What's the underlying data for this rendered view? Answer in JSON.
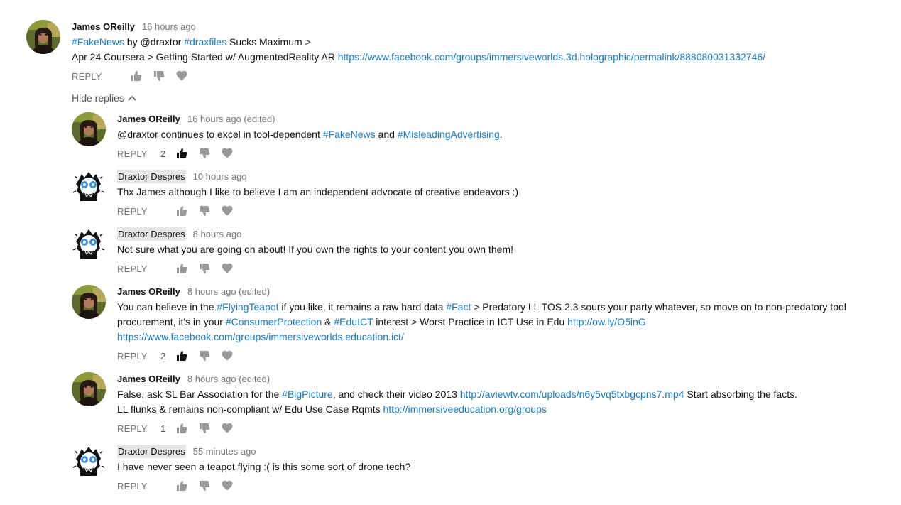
{
  "colors": {
    "link": "#167ac6",
    "meta": "#767676",
    "icon_idle": "#999999",
    "icon_active": "#111111",
    "author_highlight": "#e6e6e6"
  },
  "top_comment": {
    "author": "James OReilly",
    "time": "16 hours ago",
    "line1": {
      "tag1": "#FakeNews",
      "t1": " by @draxtor ",
      "tag2": "#draxfiles",
      "t2": " Sucks Maximum >"
    },
    "line2": {
      "t1": "Apr 24 Coursera > Getting Started w/ AugmentedReality AR ",
      "link": "https://www.facebook.com/groups/immersiveworlds.3d.holographic/permalink/888080031332746/"
    },
    "reply_label": "REPLY"
  },
  "hide_replies_label": "Hide replies",
  "replies": [
    {
      "author": "James OReilly",
      "time": "16 hours ago (edited)",
      "likes": "2",
      "text": {
        "t1": "@draxtor continues to excel in tool-dependent ",
        "tag1": "#FakeNews",
        "t2": " and ",
        "tag2": "#MisleadingAdvertising",
        "t3": "."
      },
      "reply_label": "REPLY"
    },
    {
      "author": "Draxtor Despres",
      "time": "10 hours ago",
      "text": "Thx James although I like to believe I am an independent advocate of creative endeavors :)",
      "reply_label": "REPLY"
    },
    {
      "author": "Draxtor Despres",
      "time": "8 hours ago",
      "text": "Not sure what you are going on about! If you own the rights to your content you own them!",
      "reply_label": "REPLY"
    },
    {
      "author": "James OReilly",
      "time": "8 hours ago (edited)",
      "likes": "2",
      "text": {
        "t1": "You can believe in the ",
        "tag1": "#FlyingTeapot",
        "t2": " if you like, it remains a raw hard data ",
        "tag2": "#Fact",
        "t3": " > Predatory LL TOS 2.3 sours your party whatever, so move on to non-predatory tool procurement, it's in your ",
        "tag3": "#ConsumerProtection",
        "t4": " & ",
        "tag4": "#EduICT",
        "t5": " interest > Worst Practice in ICT Use in Edu ",
        "link1": "http://ow.ly/O5inG",
        "link2": "https://www.facebook.com/groups/immersiveworlds.education.ict/"
      },
      "reply_label": "REPLY"
    },
    {
      "author": "James OReilly",
      "time": "8 hours ago (edited)",
      "likes": "1",
      "text": {
        "t1": "False, ask SL Bar Association for the ",
        "tag1": "#BigPicture",
        "t2": ", and check their video 2013 ",
        "link1": "http://aviewtv.com/uploads/n6y5vq5txbgcpns7.mp4",
        "t3": " Start absorbing the facts.",
        "t4": "LL flunks & remains non-compliant w/ Edu Use Case Rqmts ",
        "link2": "http://immersiveeducation.org/groups"
      },
      "reply_label": "REPLY"
    },
    {
      "author": "Draxtor Despres",
      "time": "55 minutes ago",
      "text": "I have never seen a teapot flying :( is this some sort of drone tech?",
      "reply_label": "REPLY"
    }
  ]
}
